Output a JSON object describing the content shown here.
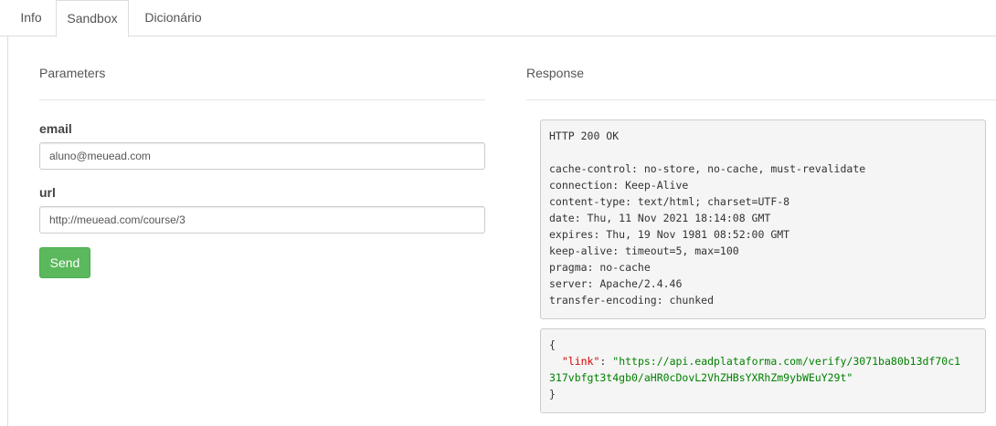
{
  "tabs": [
    {
      "label": "Info"
    },
    {
      "label": "Sandbox"
    },
    {
      "label": "Dicionário"
    }
  ],
  "parameters": {
    "title": "Parameters",
    "fields": [
      {
        "label": "email",
        "value": "aluno@meuead.com"
      },
      {
        "label": "url",
        "value": "http://meuead.com/course/3"
      }
    ],
    "send_label": "Send"
  },
  "response": {
    "title": "Response",
    "status_line": "HTTP 200 OK",
    "headers": [
      "cache-control: no-store, no-cache, must-revalidate",
      "connection: Keep-Alive",
      "content-type: text/html; charset=UTF-8",
      "date: Thu, 11 Nov 2021 18:14:08 GMT",
      "expires: Thu, 19 Nov 1981 08:52:00 GMT",
      "keep-alive: timeout=5, max=100",
      "pragma: no-cache",
      "server: Apache/2.4.46",
      "transfer-encoding: chunked"
    ],
    "body": {
      "open_brace": "{",
      "key": "\"link\"",
      "colon": ": ",
      "value_line1": "\"https://api.eadplataforma.com/verify/3071ba80b13df70c1",
      "value_line2": "317vbfgt3t4gb0/aHR0cDovL2VhZHBsYXRhZm9ybWEuY29t\"",
      "close_brace": "}"
    }
  }
}
